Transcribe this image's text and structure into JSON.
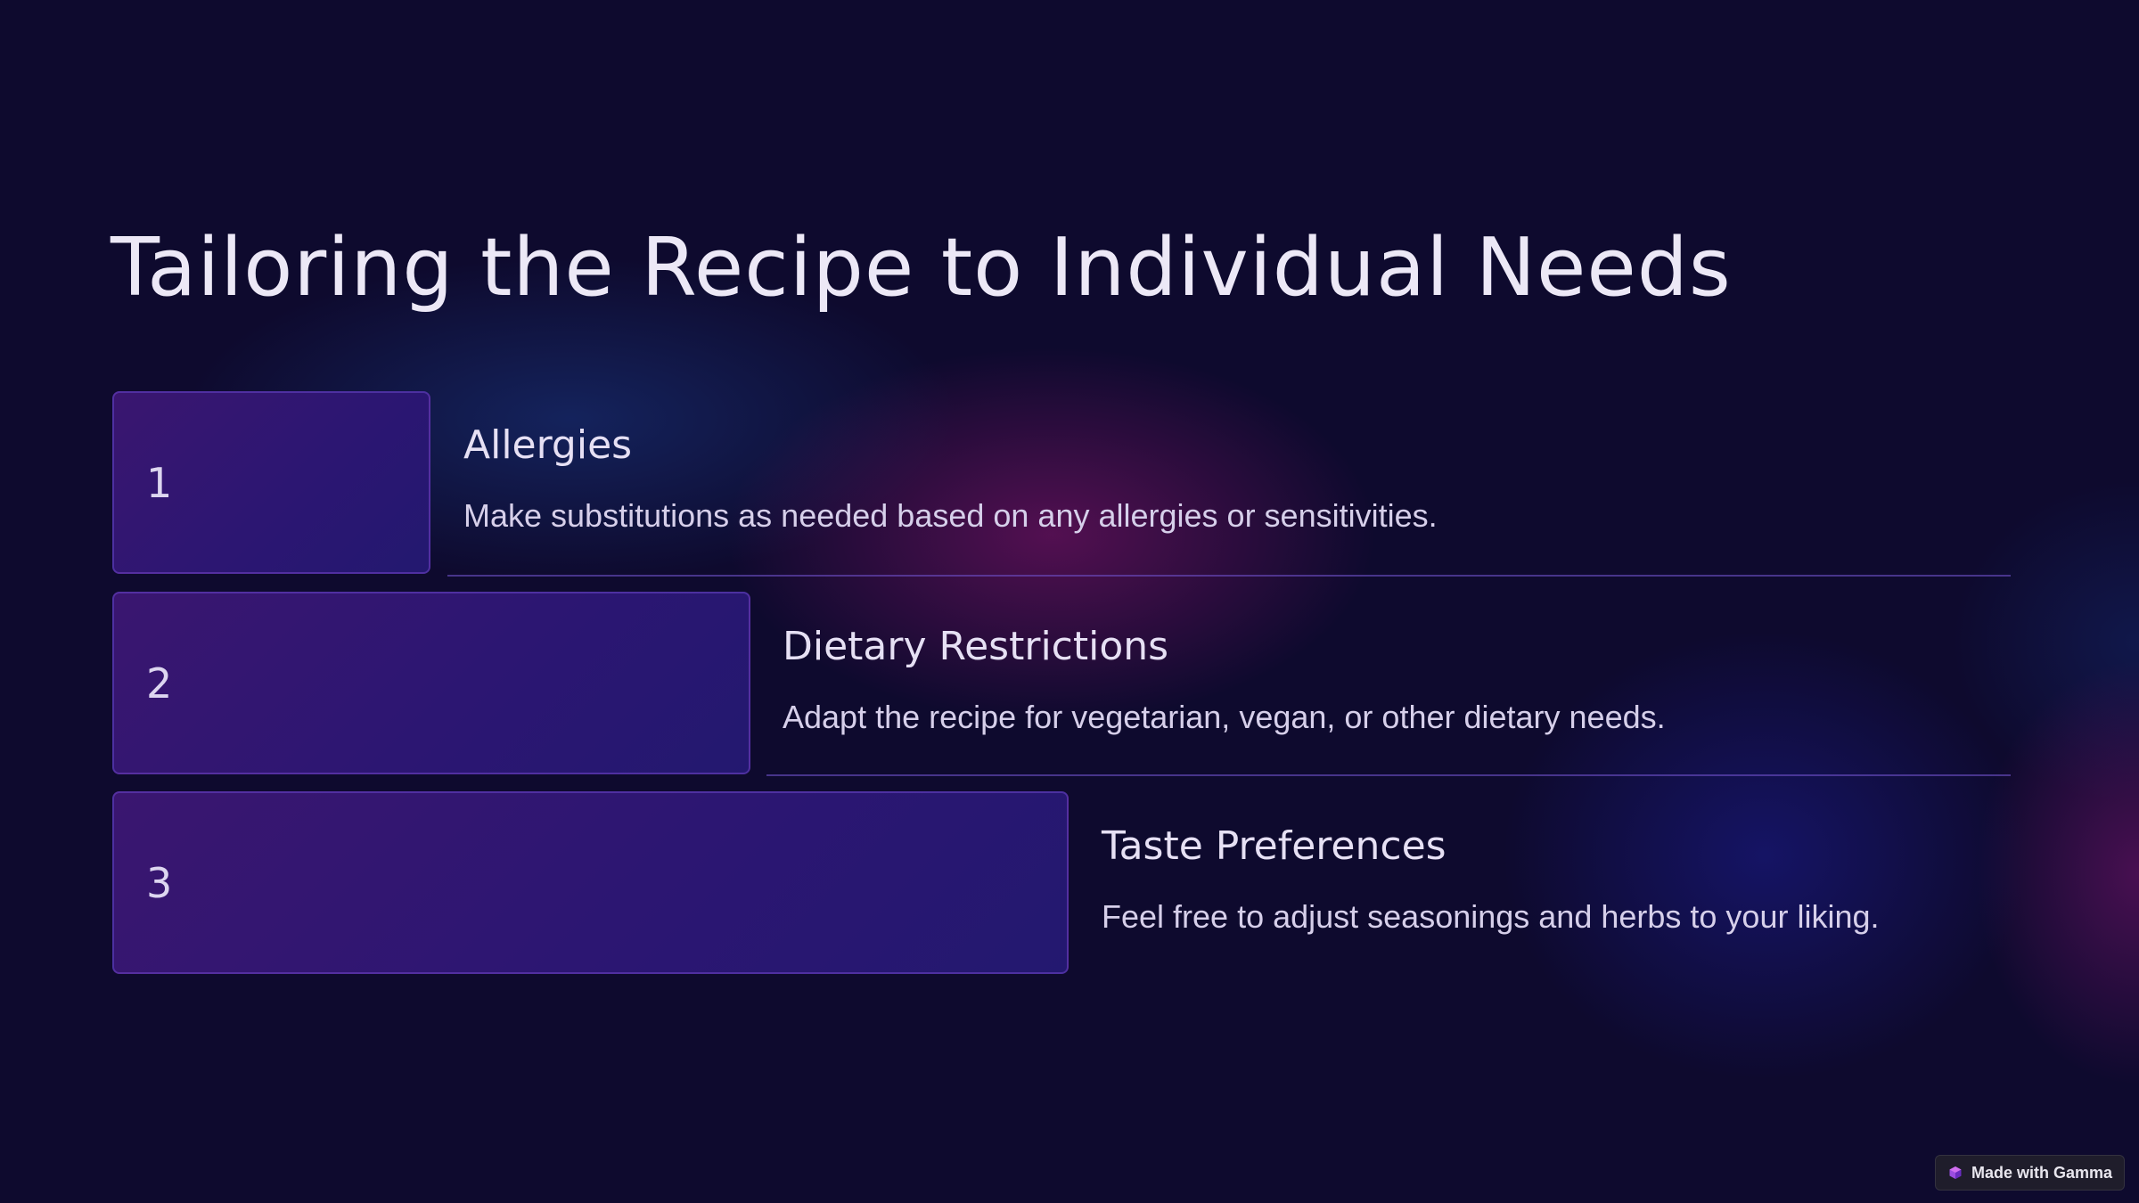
{
  "slide": {
    "title": "Tailoring the Recipe to Individual Needs",
    "steps": [
      {
        "number": "1",
        "title": "Allergies",
        "description": "Make substitutions as needed based on any allergies or sensitivities."
      },
      {
        "number": "2",
        "title": "Dietary Restrictions",
        "description": "Adapt the recipe for vegetarian, vegan, or other dietary needs."
      },
      {
        "number": "3",
        "title": "Taste Preferences",
        "description": "Feel free to adjust seasonings and herbs to your liking."
      }
    ]
  },
  "badge": {
    "label": "Made with Gamma",
    "icon": "gamma-logo-icon"
  },
  "colors": {
    "background": "#0e0a2e",
    "box_fill": "#2c1672",
    "box_border": "#6e46c8",
    "text": "#ece8f6",
    "divider": "#6e50c8"
  }
}
